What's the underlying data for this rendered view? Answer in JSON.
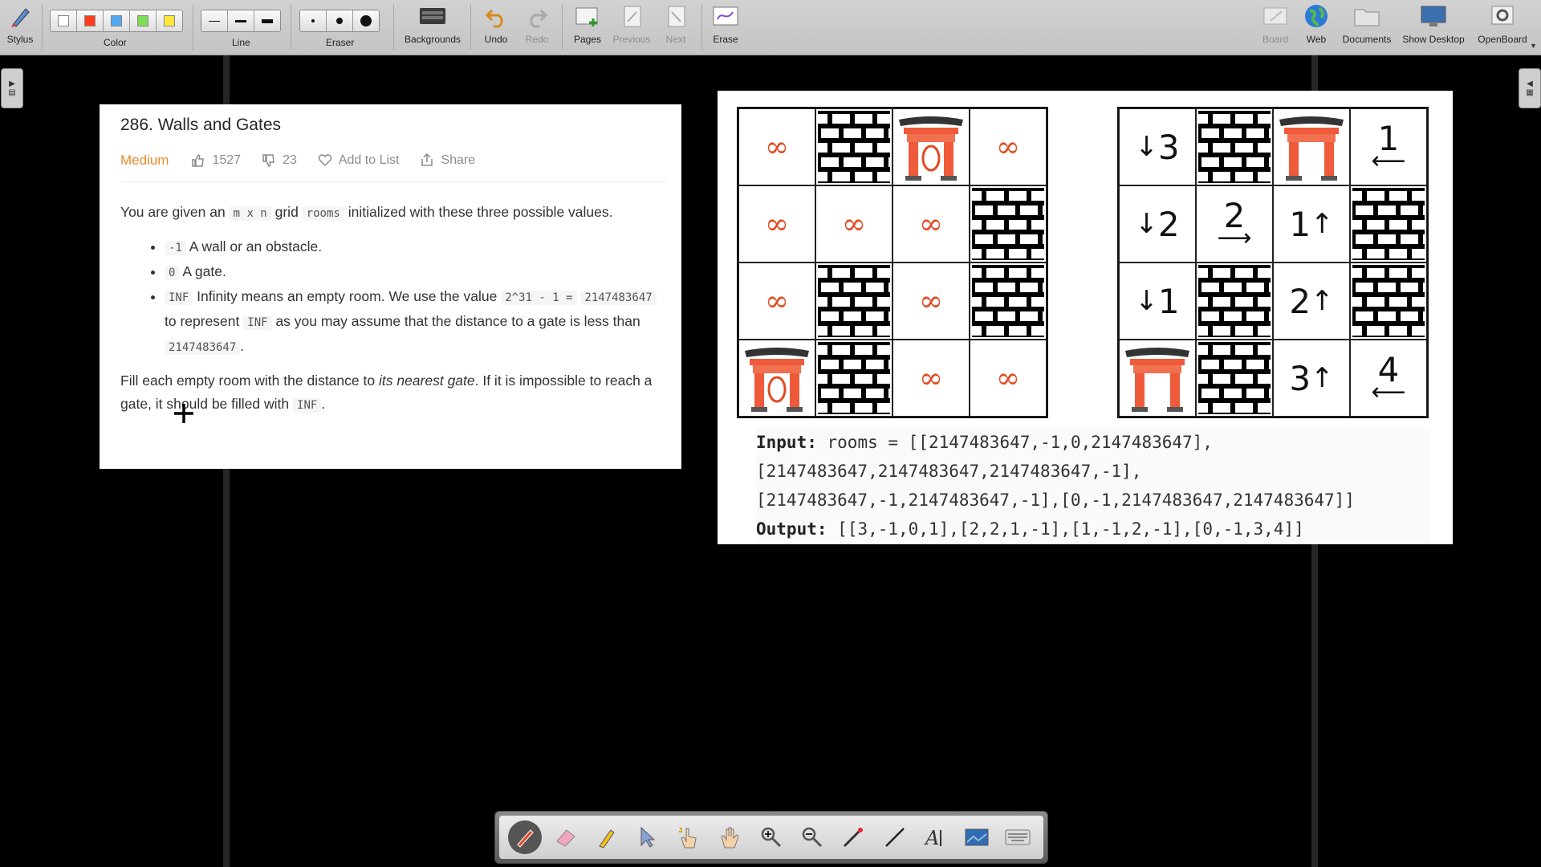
{
  "toolbar": {
    "stylus": "Stylus",
    "color": "Color",
    "line": "Line",
    "eraser": "Eraser",
    "backgrounds": "Backgrounds",
    "undo": "Undo",
    "redo": "Redo",
    "pages": "Pages",
    "previous": "Previous",
    "next": "Next",
    "erase": "Erase",
    "board": "Board",
    "web": "Web",
    "documents": "Documents",
    "show_desktop": "Show Desktop",
    "openboard": "OpenBoard",
    "colors": [
      "#ffffff",
      "#ff3b1f",
      "#55a8ef",
      "#7fdc5a",
      "#ffe83a"
    ]
  },
  "problem": {
    "title": "286. Walls and Gates",
    "difficulty": "Medium",
    "likes": "1527",
    "dislikes": "23",
    "add_to_list": "Add to List",
    "share": "Share",
    "intro_1": "You are given an",
    "m_x_n": "m x n",
    "intro_2": "grid",
    "rooms": "rooms",
    "intro_3": "initialized with these three possible values.",
    "b1_code": "-1",
    "b1_text": "A wall or an obstacle.",
    "b2_code": "0",
    "b2_text": "A gate.",
    "b3_code": "INF",
    "b3_text_1": "Infinity means an empty room. We use the value",
    "b3_formula": "2^31 - 1 =",
    "b3_value": "2147483647",
    "b3_text_2": "to represent",
    "b3_inf": "INF",
    "b3_text_3": "as you may assume that the distance to a gate is less than",
    "b3_value2": "2147483647",
    "fill_1": "Fill each empty room with the distance to",
    "fill_em": "its nearest gate",
    "fill_2": ". If it is impossible to reach a gate, it should be filled with",
    "fill_inf": "INF",
    "fill_end": "."
  },
  "example": {
    "input_label": "Input:",
    "input_line1": "rooms = [[2147483647,-1,0,2147483647],",
    "input_line2": "[2147483647,2147483647,2147483647,-1],",
    "input_line3": "[2147483647,-1,2147483647,-1],[0,-1,2147483647,2147483647]]",
    "output_label": "Output:",
    "output_value": "[[3,-1,0,1],[2,2,1,-1],[1,-1,2,-1],[0,-1,3,4]]",
    "left_grid": [
      [
        "INF",
        "WALL",
        "GATE",
        "INF"
      ],
      [
        "INF",
        "INF",
        "INF",
        "WALL"
      ],
      [
        "INF",
        "WALL",
        "INF",
        "WALL"
      ],
      [
        "GATE",
        "WALL",
        "INF",
        "INF"
      ]
    ],
    "right_grid": [
      [
        "3",
        "WALL",
        "GATE",
        "1"
      ],
      [
        "2",
        "2",
        "1",
        "WALL"
      ],
      [
        "1",
        "WALL",
        "2",
        "WALL"
      ],
      [
        "GATE",
        "WALL",
        "3",
        "4"
      ]
    ]
  }
}
